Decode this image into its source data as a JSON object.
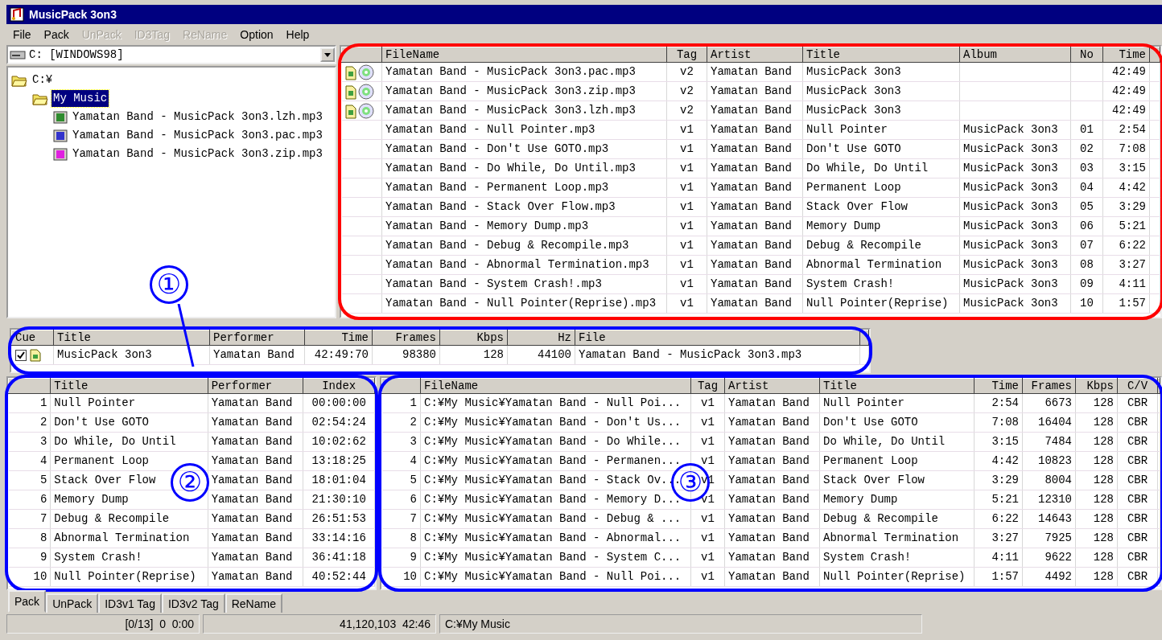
{
  "window": {
    "title": "MusicPack 3on3"
  },
  "menu": [
    {
      "label": "File",
      "disabled": false
    },
    {
      "label": "Pack",
      "disabled": false
    },
    {
      "label": "UnPack",
      "disabled": true
    },
    {
      "label": "ID3Tag",
      "disabled": true
    },
    {
      "label": "ReName",
      "disabled": true
    },
    {
      "label": "Option",
      "disabled": false
    },
    {
      "label": "Help",
      "disabled": false
    }
  ],
  "drive_select": {
    "value": "C: [WINDOWS98]"
  },
  "tree": [
    {
      "label": "C:¥",
      "selected": false,
      "children": [
        {
          "label": "My Music",
          "selected": true,
          "children": [
            {
              "label": "Yamatan Band - MusicPack 3on3.lzh.mp3",
              "selected": false,
              "color": "#2e8b2e"
            },
            {
              "label": "Yamatan Band - MusicPack 3on3.pac.mp3",
              "selected": false,
              "color": "#3333cc"
            },
            {
              "label": "Yamatan Band - MusicPack 3on3.zip.mp3",
              "selected": false,
              "color": "#e020e0"
            }
          ]
        }
      ]
    }
  ],
  "file_list": {
    "color": "#ff0000",
    "columns": [
      "FileName",
      "Tag",
      "Artist",
      "Title",
      "Album",
      "No",
      "Time"
    ],
    "rows": [
      {
        "kind": "archive",
        "filename": "Yamatan Band - MusicPack 3on3.pac.mp3",
        "tag": "v2",
        "artist": "Yamatan Band",
        "title": "MusicPack 3on3",
        "time": "42:49"
      },
      {
        "kind": "archive",
        "filename": "Yamatan Band - MusicPack 3on3.zip.mp3",
        "tag": "v2",
        "artist": "Yamatan Band",
        "title": "MusicPack 3on3",
        "time": "42:49"
      },
      {
        "kind": "archive",
        "filename": "Yamatan Band - MusicPack 3on3.lzh.mp3",
        "tag": "v2",
        "artist": "Yamatan Band",
        "title": "MusicPack 3on3",
        "time": "42:49"
      },
      {
        "kind": "track",
        "filename": "Yamatan Band - Null Pointer.mp3",
        "tag": "v1",
        "artist": "Yamatan Band",
        "title": "Null Pointer",
        "album": "MusicPack 3on3",
        "no": "01",
        "time": "2:54"
      },
      {
        "kind": "track",
        "filename": "Yamatan Band - Don't Use GOTO.mp3",
        "tag": "v1",
        "artist": "Yamatan Band",
        "title": "Don't Use GOTO",
        "album": "MusicPack 3on3",
        "no": "02",
        "time": "7:08"
      },
      {
        "kind": "track",
        "filename": "Yamatan Band - Do While, Do Until.mp3",
        "tag": "v1",
        "artist": "Yamatan Band",
        "title": "Do While, Do Until",
        "album": "MusicPack 3on3",
        "no": "03",
        "time": "3:15"
      },
      {
        "kind": "track",
        "filename": "Yamatan Band - Permanent Loop.mp3",
        "tag": "v1",
        "artist": "Yamatan Band",
        "title": "Permanent Loop",
        "album": "MusicPack 3on3",
        "no": "04",
        "time": "4:42"
      },
      {
        "kind": "track",
        "filename": "Yamatan Band - Stack Over Flow.mp3",
        "tag": "v1",
        "artist": "Yamatan Band",
        "title": "Stack Over Flow",
        "album": "MusicPack 3on3",
        "no": "05",
        "time": "3:29"
      },
      {
        "kind": "track",
        "filename": "Yamatan Band - Memory Dump.mp3",
        "tag": "v1",
        "artist": "Yamatan Band",
        "title": "Memory Dump",
        "album": "MusicPack 3on3",
        "no": "06",
        "time": "5:21"
      },
      {
        "kind": "track",
        "filename": "Yamatan Band - Debug & Recompile.mp3",
        "tag": "v1",
        "artist": "Yamatan Band",
        "title": "Debug & Recompile",
        "album": "MusicPack 3on3",
        "no": "07",
        "time": "6:22"
      },
      {
        "kind": "track",
        "filename": "Yamatan Band - Abnormal Termination.mp3",
        "tag": "v1",
        "artist": "Yamatan Band",
        "title": "Abnormal Termination",
        "album": "MusicPack 3on3",
        "no": "08",
        "time": "3:27"
      },
      {
        "kind": "track",
        "filename": "Yamatan Band - System Crash!.mp3",
        "tag": "v1",
        "artist": "Yamatan Band",
        "title": "System Crash!",
        "album": "MusicPack 3on3",
        "no": "09",
        "time": "4:11"
      },
      {
        "kind": "track",
        "filename": "Yamatan Band - Null Pointer(Reprise).mp3",
        "tag": "v1",
        "artist": "Yamatan Band",
        "title": "Null Pointer(Reprise)",
        "album": "MusicPack 3on3",
        "no": "10",
        "time": "1:57"
      }
    ]
  },
  "cue": {
    "callout": "①",
    "color": "#0000ff",
    "columns": [
      "Cue",
      "Title",
      "Performer",
      "Time",
      "Frames",
      "Kbps",
      "Hz",
      "File"
    ],
    "rows": [
      {
        "checked": true,
        "title": "MusicPack 3on3",
        "performer": "Yamatan Band",
        "time": "42:49:70",
        "frames": "98380",
        "kbps": "128",
        "hz": "44100",
        "file": "Yamatan Band - MusicPack 3on3.mp3"
      }
    ]
  },
  "tracks": {
    "callout": "②",
    "color": "#0000ff",
    "columns": [
      "Title",
      "Performer",
      "Index"
    ],
    "rows": [
      {
        "number": "1",
        "title": "Null Pointer",
        "performer": "Yamatan Band",
        "index": "00:00:00"
      },
      {
        "number": "2",
        "title": "Don't Use GOTO",
        "performer": "Yamatan Band",
        "index": "02:54:24"
      },
      {
        "number": "3",
        "title": "Do While, Do Until",
        "performer": "Yamatan Band",
        "index": "10:02:62"
      },
      {
        "number": "4",
        "title": "Permanent Loop",
        "performer": "Yamatan Band",
        "index": "13:18:25"
      },
      {
        "number": "5",
        "title": "Stack Over Flow",
        "performer": "Yamatan Band",
        "index": "18:01:04"
      },
      {
        "number": "6",
        "title": "Memory Dump",
        "performer": "Yamatan Band",
        "index": "21:30:10"
      },
      {
        "number": "7",
        "title": "Debug & Recompile",
        "performer": "Yamatan Band",
        "index": "26:51:53"
      },
      {
        "number": "8",
        "title": "Abnormal Termination",
        "performer": "Yamatan Band",
        "index": "33:14:16"
      },
      {
        "number": "9",
        "title": "System Crash!",
        "performer": "Yamatan Band",
        "index": "36:41:18"
      },
      {
        "number": "10",
        "title": "Null Pointer(Reprise)",
        "performer": "Yamatan Band",
        "index": "40:52:44"
      }
    ]
  },
  "track_files": {
    "callout": "③",
    "color": "#0000ff",
    "columns": [
      "FileName",
      "Tag",
      "Artist",
      "Title",
      "Time",
      "Frames",
      "Kbps",
      "C/V"
    ],
    "rows": [
      {
        "number": "1",
        "filename": "C:¥My Music¥Yamatan Band - Null Poi...",
        "tag": "v1",
        "artist": "Yamatan Band",
        "title": "Null Pointer",
        "time": "2:54",
        "frames": "6673",
        "kbps": "128",
        "cv": "CBR"
      },
      {
        "number": "2",
        "filename": "C:¥My Music¥Yamatan Band - Don't Us...",
        "tag": "v1",
        "artist": "Yamatan Band",
        "title": "Don't Use GOTO",
        "time": "7:08",
        "frames": "16404",
        "kbps": "128",
        "cv": "CBR"
      },
      {
        "number": "3",
        "filename": "C:¥My Music¥Yamatan Band - Do While...",
        "tag": "v1",
        "artist": "Yamatan Band",
        "title": "Do While, Do Until",
        "time": "3:15",
        "frames": "7484",
        "kbps": "128",
        "cv": "CBR"
      },
      {
        "number": "4",
        "filename": "C:¥My Music¥Yamatan Band - Permanen...",
        "tag": "v1",
        "artist": "Yamatan Band",
        "title": "Permanent Loop",
        "time": "4:42",
        "frames": "10823",
        "kbps": "128",
        "cv": "CBR"
      },
      {
        "number": "5",
        "filename": "C:¥My Music¥Yamatan Band - Stack Ov...",
        "tag": "v1",
        "artist": "Yamatan Band",
        "title": "Stack Over Flow",
        "time": "3:29",
        "frames": "8004",
        "kbps": "128",
        "cv": "CBR"
      },
      {
        "number": "6",
        "filename": "C:¥My Music¥Yamatan Band - Memory D...",
        "tag": "v1",
        "artist": "Yamatan Band",
        "title": "Memory Dump",
        "time": "5:21",
        "frames": "12310",
        "kbps": "128",
        "cv": "CBR"
      },
      {
        "number": "7",
        "filename": "C:¥My Music¥Yamatan Band - Debug & ...",
        "tag": "v1",
        "artist": "Yamatan Band",
        "title": "Debug & Recompile",
        "time": "6:22",
        "frames": "14643",
        "kbps": "128",
        "cv": "CBR"
      },
      {
        "number": "8",
        "filename": "C:¥My Music¥Yamatan Band - Abnormal...",
        "tag": "v1",
        "artist": "Yamatan Band",
        "title": "Abnormal Termination",
        "time": "3:27",
        "frames": "7925",
        "kbps": "128",
        "cv": "CBR"
      },
      {
        "number": "9",
        "filename": "C:¥My Music¥Yamatan Band - System C...",
        "tag": "v1",
        "artist": "Yamatan Band",
        "title": "System Crash!",
        "time": "4:11",
        "frames": "9622",
        "kbps": "128",
        "cv": "CBR"
      },
      {
        "number": "10",
        "filename": "C:¥My Music¥Yamatan Band - Null Poi...",
        "tag": "v1",
        "artist": "Yamatan Band",
        "title": "Null Pointer(Reprise)",
        "time": "1:57",
        "frames": "4492",
        "kbps": "128",
        "cv": "CBR"
      }
    ]
  },
  "tabs": [
    {
      "label": "Pack",
      "selected": true
    },
    {
      "label": "UnPack",
      "selected": false
    },
    {
      "label": "ID3v1 Tag",
      "selected": false
    },
    {
      "label": "ID3v2 Tag",
      "selected": false
    },
    {
      "label": "ReName",
      "selected": false
    }
  ],
  "status_bar": [
    "[0/13]  0  0:00",
    "41,120,103  42:46",
    "C:¥My Music"
  ]
}
